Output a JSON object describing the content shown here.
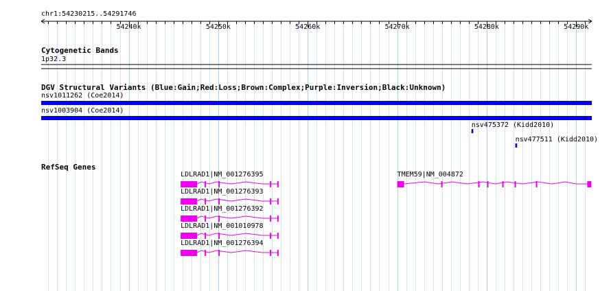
{
  "ruler": {
    "location": "chr1:54230215..54291746",
    "start": 54230215,
    "end": 54291746,
    "tick_labels": [
      {
        "pos": 54240000,
        "label": "54240k"
      },
      {
        "pos": 54250000,
        "label": "54250k"
      },
      {
        "pos": 54260000,
        "label": "54260k"
      },
      {
        "pos": 54270000,
        "label": "54270k"
      },
      {
        "pos": 54280000,
        "label": "54280k"
      },
      {
        "pos": 54290000,
        "label": "54290k"
      }
    ]
  },
  "tracks": {
    "cytoband": {
      "title": "Cytogenetic Bands",
      "band_label": "1p32.3"
    },
    "dgv": {
      "title": "DGV Structural Variants (Blue:Gain;Red:Loss;Brown:Complex;Purple:Inversion;Black:Unknown)",
      "features": [
        {
          "label": "nsv1011262 (Coe2014)",
          "start": 54230215,
          "end": 54291746,
          "color": "#0000ee"
        },
        {
          "label": "nsv1003904 (Coe2014)",
          "start": 54230215,
          "end": 54291746,
          "color": "#0000ee"
        },
        {
          "label": "nsv475372 (Kidd2010)",
          "start": 54278300,
          "end": 54278500,
          "color": "#0000ee"
        },
        {
          "label": "nsv477511 (Kidd2010)",
          "start": 54283200,
          "end": 54283400,
          "color": "#0000ee"
        }
      ]
    },
    "refseq": {
      "title": "RefSeq Genes",
      "color": "#ee00ee",
      "genes": [
        {
          "label": "LDLRAD1|NM_001276395",
          "start": 54245800,
          "end": 54256750
        },
        {
          "label": "LDLRAD1|NM_001276393",
          "start": 54245800,
          "end": 54256750
        },
        {
          "label": "LDLRAD1|NM_001276392",
          "start": 54245800,
          "end": 54256750
        },
        {
          "label": "LDLRAD1|NM_001010978",
          "start": 54245800,
          "end": 54256750
        },
        {
          "label": "LDLRAD1|NM_001276394",
          "start": 54245800,
          "end": 54256750
        },
        {
          "label": "TMEM59|NM_004872",
          "start": 54270000,
          "end": 54291700
        }
      ]
    }
  }
}
